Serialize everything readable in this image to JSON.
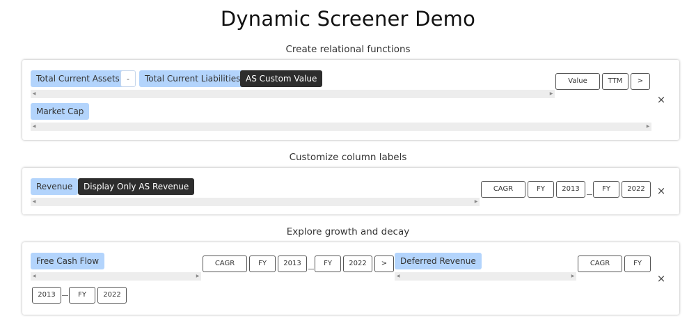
{
  "page_title": "Dynamic Screener Demo",
  "sections": [
    {
      "heading": "Create relational functions",
      "row1_chips": [
        "Total Current Assets",
        "-",
        "Total Current Liabilities",
        "AS Custom Value"
      ],
      "row2_chips": [
        "Market Cap"
      ],
      "controls": [
        "Value",
        "TTM",
        ">"
      ],
      "close": "×"
    },
    {
      "heading": "Customize column labels",
      "chips": [
        "Revenue",
        "Display Only AS Revenue"
      ],
      "controls": [
        "CAGR",
        "FY",
        "2013",
        "FY",
        "2022"
      ],
      "close": "×"
    },
    {
      "heading": "Explore growth and decay",
      "left_chip": "Free Cash Flow",
      "mid_controls": [
        "CAGR",
        "FY",
        "2013",
        "FY",
        "2022",
        ">"
      ],
      "right_chip": "Deferred Revenue",
      "right_controls": [
        "CAGR",
        "FY"
      ],
      "bottom_controls": [
        "2013",
        "FY",
        "2022"
      ],
      "close": "×"
    }
  ],
  "icons": {
    "scroll_left": "◀",
    "scroll_right": "▶"
  }
}
